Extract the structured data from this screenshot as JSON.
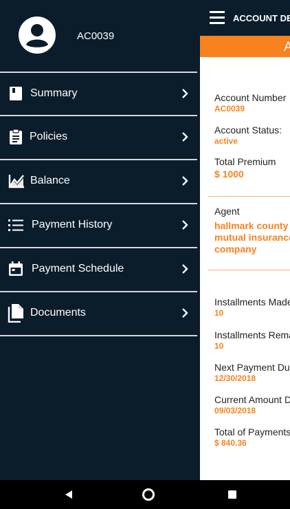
{
  "header": {
    "title": "ACCOUNT DETAILS",
    "banner_text": "A"
  },
  "account": {
    "number_label": "Account Number",
    "number_value": "AC0039",
    "status_label": "Account Status:",
    "status_value": "active",
    "premium_label": "Total Premium",
    "premium_value": "$ 1000"
  },
  "agent": {
    "label": "Agent",
    "line1": "hallmark county",
    "line2": "mutual insurance",
    "line3": "company"
  },
  "installments": {
    "made_label": "Installments Made",
    "made_value": "10",
    "remaining_label": "Installments Remaining",
    "remaining_value": "10",
    "next_due_label": "Next Payment Due",
    "next_due_value": "12/30/2018",
    "current_amount_label": "Current Amount Due",
    "current_amount_value": "09/03/2018",
    "total_payments_label": "Total of Payments",
    "total_payments_value": "$ 840.36"
  },
  "drawer": {
    "account_id": "AC0039",
    "items": [
      {
        "label": "Summary",
        "icon": "book-icon"
      },
      {
        "label": "Policies",
        "icon": "clipboard-icon"
      },
      {
        "label": "Balance",
        "icon": "chart-icon"
      },
      {
        "label": "Payment History",
        "icon": "list-icon"
      },
      {
        "label": "Payment Schedule",
        "icon": "calendar-icon"
      },
      {
        "label": "Documents",
        "icon": "document-icon"
      }
    ]
  },
  "system_nav": {
    "back": "back-icon",
    "home": "home-icon",
    "recents": "recents-icon"
  },
  "colors": {
    "drawer_bg": "#0b1c2b",
    "accent": "#f7821e",
    "divider": "#d7d9dc"
  }
}
